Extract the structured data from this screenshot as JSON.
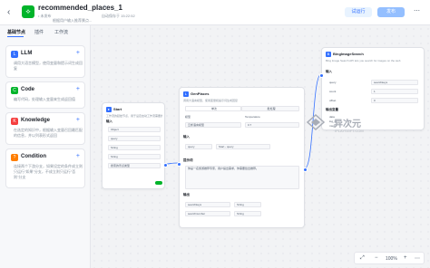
{
  "header": {
    "title": "recommended_places_1",
    "meta": "• 未发布",
    "subtitle": "根据用户输入推荐景点...",
    "save_status": "自动保存于 15:22:52",
    "test_label": "试运行",
    "publish_label": "发布"
  },
  "sidebar": {
    "tabs": [
      "基础节点",
      "插件",
      "工作流"
    ],
    "cards": [
      {
        "title": "LLM",
        "desc": "调用大语言模型，使用变量和提示词生成回复",
        "color": "#3370ff",
        "icon": "L"
      },
      {
        "title": "Code",
        "desc": "编写代码，处理输入变量来生成返回值",
        "color": "#00b42a",
        "icon": "C"
      },
      {
        "title": "Knowledge",
        "desc": "在选定的知识中，根据输入变量召回最匹配的信息，并以列表形式返回",
        "color": "#f53f3f",
        "icon": "K"
      },
      {
        "title": "Condition",
        "desc": "连接两个下游分支，如果设定的条件成立则只运行\"如果\"分支，不成立则只运行\"否则\"分支",
        "color": "#ff7d00",
        "icon": "?"
      }
    ]
  },
  "nodes": {
    "start": {
      "title": "Start",
      "desc": "工作流的起始节点，用于设定启动工作流需要的信息",
      "input_label": "输入",
      "params": [
        "Object",
        "query",
        "String",
        "String",
        "搜索的景点类型"
      ]
    },
    "llm": {
      "title": "GenPlaces",
      "desc": "调用大语言模型，使用变量和提示词生成回复",
      "tab1": "单次",
      "tab2": "批处理",
      "model_label": "模型",
      "temp_label": "Temperature",
      "model_value": "云雀语言模型",
      "temp_value": "0.7",
      "input_label": "输入",
      "var": "query",
      "ref": "Start - query",
      "prompt_label": "提示词",
      "prompt": "你是一名旅游推荐专家，用户提出需求，你需要给出推荐。",
      "output_label": "输出",
      "out1": "searchkeys",
      "out2": "searchnumber",
      "out_type": "String"
    },
    "plugin": {
      "title": "BingImageSearch",
      "desc": "Bing Image Search API lets you search for images on the web",
      "input_label": "输入",
      "p1": "query",
      "p2": "count",
      "p3": "offset",
      "p1v": "searchkeys",
      "p2v": "1",
      "p3v": "0",
      "output_label": "输出变量",
      "o1": "data",
      "o2": "log_id",
      "o3": "msg"
    }
  },
  "watermark": {
    "title": "异次元",
    "sub": "IPLAYSOFT.COM"
  },
  "zoom": {
    "level": "100%"
  }
}
